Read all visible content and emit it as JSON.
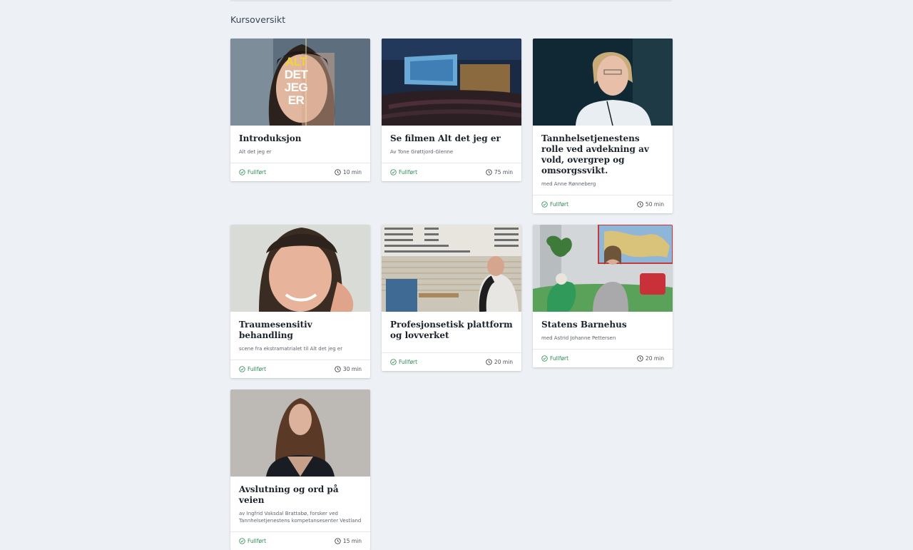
{
  "page": {
    "title": "Kursoversikt"
  },
  "courses": [
    {
      "title": "Introduksjon",
      "subtitle": "Alt det jeg er",
      "status": "Fullført",
      "duration": "10 min",
      "thumb_text": [
        "ALT",
        "DET",
        "JEG",
        "ER"
      ]
    },
    {
      "title": "Se filmen Alt det jeg er",
      "subtitle": "Av Tone Grøttjord-Glenne",
      "status": "Fullført",
      "duration": "75 min"
    },
    {
      "title": "Tannhelsetjenestens rolle ved avdekning av vold, overgrep og omsorgssvikt.",
      "subtitle": "med Anne Rønneberg",
      "status": "Fullført",
      "duration": "50 min"
    },
    {
      "title": "Traumesensitiv behandling",
      "subtitle": "scene fra ekstramatrialet til Alt det jeg er",
      "status": "Fullført",
      "duration": "30 min"
    },
    {
      "title": "Profesjonsetisk plattform og lovverket",
      "subtitle": "",
      "status": "Fullført",
      "duration": "20 min"
    },
    {
      "title": "Statens Barnehus",
      "subtitle": "med Astrid Johanne Pettersen",
      "status": "Fullført",
      "duration": "20 min"
    },
    {
      "title": "Avslutning og ord på veien",
      "subtitle": "av Ingfrid Vaksdal Brattabø, forsker ved Tannhelsetjenestens kompetansesenter Vestland",
      "status": "Fullført",
      "duration": "15 min"
    }
  ],
  "colors": {
    "background": "#edf1f5",
    "status_green": "#2e8a55"
  },
  "icons": {
    "status": "check-circle-icon",
    "duration": "clock-icon"
  }
}
